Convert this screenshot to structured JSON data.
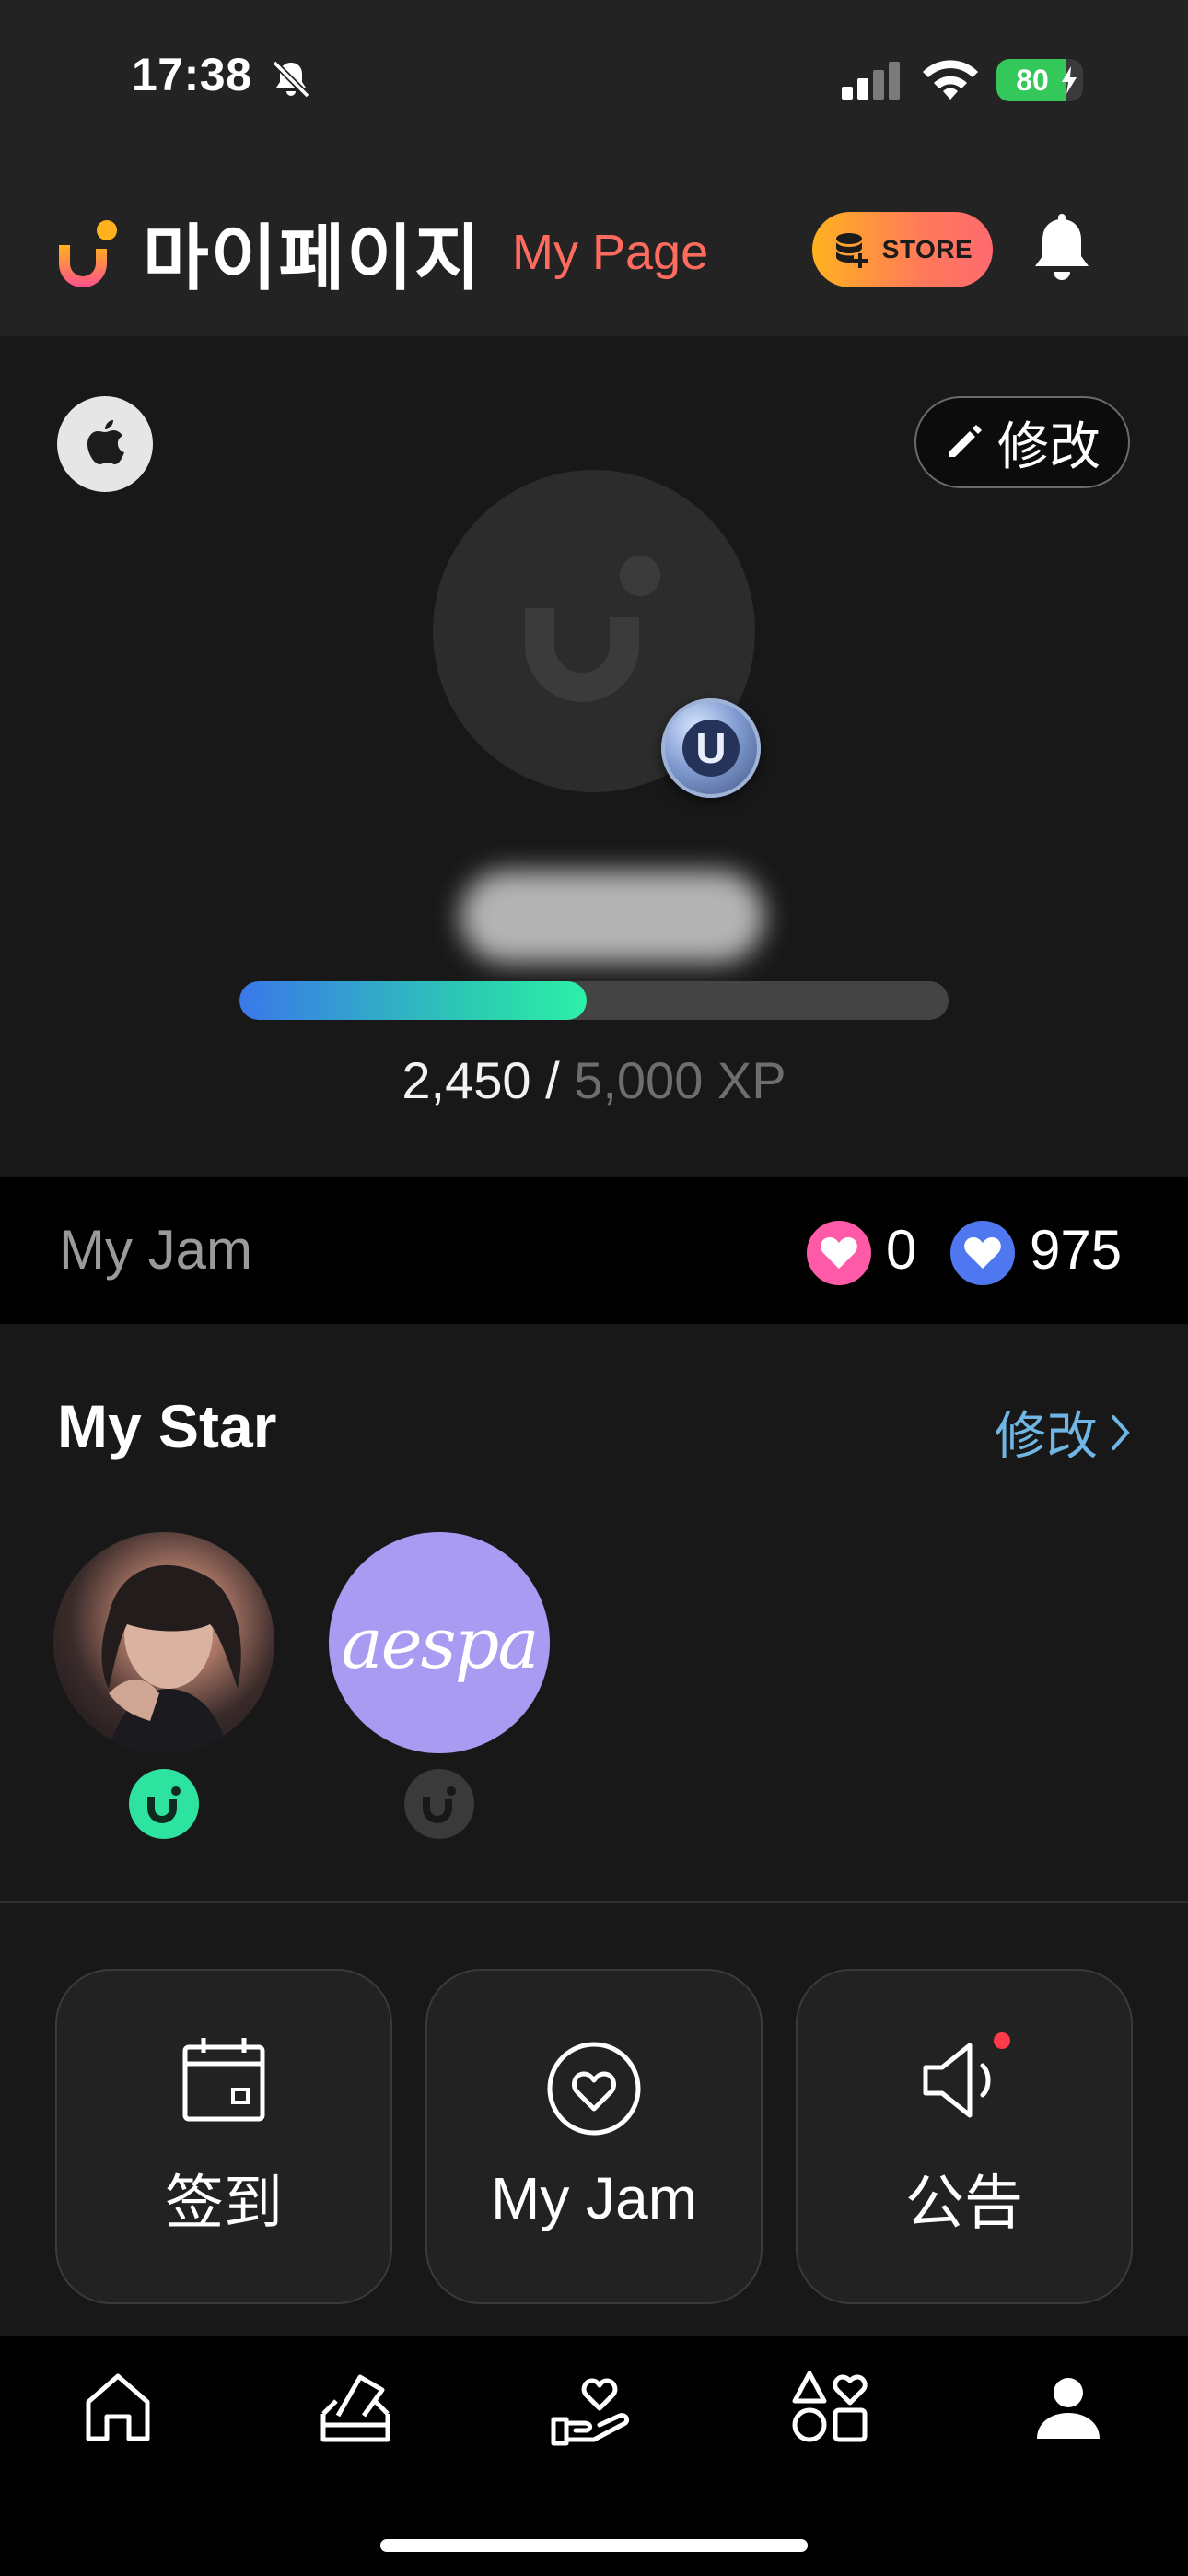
{
  "status_bar": {
    "time": "17:38",
    "battery_percent": 80,
    "battery_label": "80",
    "icons": [
      "bell-slash-icon",
      "cellular-signal-icon",
      "wifi-icon",
      "battery-charging-icon"
    ]
  },
  "header": {
    "title_ko": "마이페이지",
    "title_en": "My Page",
    "store_label": "STORE",
    "icons": [
      "app-logo-icon",
      "coins-plus-icon",
      "bell-icon"
    ]
  },
  "profile": {
    "edit_label": "修改",
    "level_badge_letter": "U",
    "xp_current": "2,450",
    "xp_separator": " / ",
    "xp_max": "5,000 XP",
    "xp_progress": 0.49,
    "icons": [
      "apple-icon",
      "pencil-icon",
      "avatar-placeholder-icon"
    ]
  },
  "my_jam": {
    "label": "My Jam",
    "pink_count": "0",
    "blue_count": "975",
    "colors": {
      "pink": "#ff5aa8",
      "blue": "#4f78f0"
    }
  },
  "my_star": {
    "title": "My Star",
    "edit_label": "修改",
    "stars": [
      {
        "avatar": "star-photo",
        "status": "active",
        "status_color": "#2de39f"
      },
      {
        "avatar": "aespa-logo",
        "logo_text": "aespa",
        "background": "#a99af2",
        "status": "inactive",
        "status_color": "#3a3a3a"
      }
    ]
  },
  "tiles": [
    {
      "label": "签到",
      "icon": "calendar-icon"
    },
    {
      "label": "My Jam",
      "icon": "heart-circle-icon"
    },
    {
      "label": "公告",
      "icon": "speaker-icon",
      "has_notification": true
    }
  ],
  "bottom_nav": {
    "items": [
      "home-icon",
      "vote-box-icon",
      "heart-hand-icon",
      "shapes-icon",
      "profile-icon"
    ],
    "active": "profile-icon"
  },
  "colors": {
    "accent": "#ff6b5e",
    "link": "#6fb6e4",
    "background": "#181818",
    "header_bg": "#232323"
  }
}
